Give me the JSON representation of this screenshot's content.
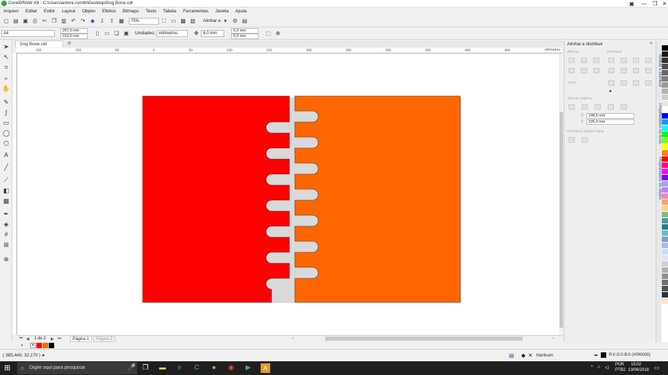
{
  "window": {
    "title": "CorelDRAW X8 - C:\\Users\\antoni.romitti\\Desktop\\Dog Bone.cdr",
    "minimize": "—",
    "restore": "❐",
    "close": "✕"
  },
  "menu": [
    "Arquivo",
    "Editar",
    "Exibir",
    "Layout",
    "Objeto",
    "Efeitos",
    "Bitmaps",
    "Texto",
    "Tabela",
    "Ferramentas",
    "Janela",
    "Ajuda"
  ],
  "toolbar": {
    "zoom": "75%",
    "align_label": "Alinhar a"
  },
  "propbar": {
    "page_size": "A4",
    "width": "297,0 mm",
    "height": "210,0 mm",
    "units_label": "Unidades:",
    "units_value": "milímetros",
    "nudge": "6,0 mm",
    "dup_x": "5,0 mm",
    "dup_y": "5,0 mm"
  },
  "doc_tab": "Dog Bone.cdr",
  "ruler_unit": "milímetros",
  "ruler_ticks": [
    "150",
    "100",
    "50",
    "0",
    "50",
    "100",
    "150",
    "200",
    "250",
    "300",
    "350",
    "400",
    "450"
  ],
  "page_nav": {
    "counter": "1 de 2",
    "page1": "Página 1",
    "page2": "Página 2"
  },
  "dock": {
    "title": "Alinhar e distribuir",
    "sections": [
      "Alinhar",
      "Distribuir",
      "Texto",
      "Alinhar objetos",
      "Distribuir objetos para"
    ],
    "x_value": "148,5 mm",
    "y_value": "105,0 mm"
  },
  "side_tabs": [
    "Alinhar e distribuir",
    "Propriedades do texto",
    "Propriedades do objeto"
  ],
  "palette": [
    "#000000",
    "#1a1a1a",
    "#333333",
    "#4d4d4d",
    "#666666",
    "#808080",
    "#999999",
    "#b3b3b3",
    "#cccccc",
    "#e6e6e6",
    "#ffffff",
    "#0000ff",
    "#00a0ff",
    "#00ffff",
    "#00ff00",
    "#80ff00",
    "#ffff00",
    "#ff8000",
    "#ff0000",
    "#ff0080",
    "#ff00ff",
    "#8000ff",
    "#a0a0ff",
    "#c080ff",
    "#ff80c0",
    "#ffa060",
    "#ffd080",
    "#80c080",
    "#40a0a0",
    "#208080",
    "#60c0c0",
    "#80a0c0",
    "#a0c0e0",
    "#c0e0f0",
    "#e0e0ff",
    "#d0d0d0",
    "#b0b0b0",
    "#909090",
    "#707070",
    "#505050",
    "#303030",
    "#ffe0c0"
  ],
  "status": {
    "coords": "( 385,445; 32,170 )",
    "fill_label": "Nenhum",
    "outline_label": "R:0 G:0 B:0 (#000000)"
  },
  "taskbar": {
    "search_placeholder": "Digite aqui para pesquisar",
    "lang": "POR",
    "lang2": "PTB2",
    "time": "15:02",
    "date": "13/06/2018"
  },
  "colors": {
    "left_piece": "#ff0000",
    "right_piece": "#ff6600"
  }
}
